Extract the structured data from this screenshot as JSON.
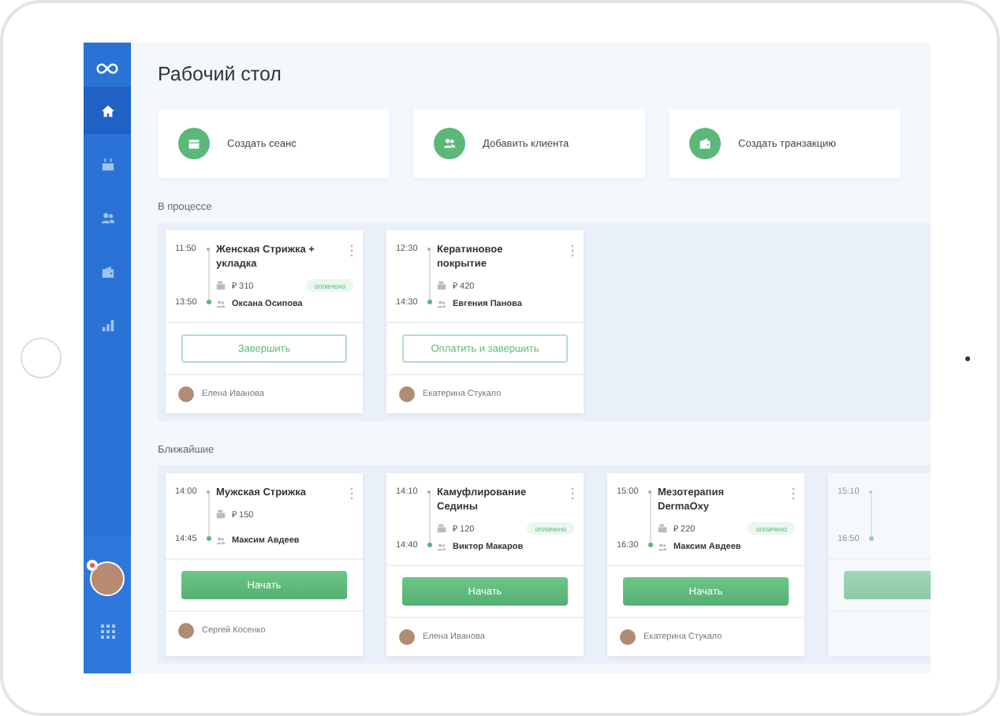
{
  "sidebar": {
    "items": [
      {
        "kind": "home",
        "selected": true
      },
      {
        "kind": "calendar",
        "selected": false
      },
      {
        "kind": "clients",
        "selected": false
      },
      {
        "kind": "wallet",
        "selected": false
      },
      {
        "kind": "stats",
        "selected": false
      }
    ]
  },
  "page_title": "Рабочий стол",
  "quick_actions": [
    {
      "kind": "calendar",
      "label": "Создать сеанс"
    },
    {
      "kind": "clients",
      "label": "Добавить клиента"
    },
    {
      "kind": "wallet",
      "label": "Создать транзакцию"
    }
  ],
  "sections": [
    {
      "title": "В процессе",
      "cards": [
        {
          "start": "11:50",
          "end": "13:50",
          "service": "Женская Стрижка + укладка",
          "price": "₽ 310",
          "badge": "оплачено",
          "client": "Оксана Осипова",
          "action": {
            "kind": "outline",
            "label": "Завершить"
          },
          "master": "Елена Иванова",
          "faded": false
        },
        {
          "start": "12:30",
          "end": "14:30",
          "service": "Кератиновое покрытие",
          "price": "₽ 420",
          "client": "Евгения Панова",
          "action": {
            "kind": "outline",
            "label": "Оплатить и завершить"
          },
          "master": "Екатерина Стукало",
          "faded": false
        }
      ]
    },
    {
      "title": "Ближайшие",
      "cards": [
        {
          "start": "14:00",
          "end": "14:45",
          "service": "Мужская Стрижка",
          "price": "₽ 150",
          "client": "Максим Авдеев",
          "action": {
            "kind": "primary",
            "label": "Начать"
          },
          "master": "Сергей Косенко",
          "faded": false
        },
        {
          "start": "14:10",
          "end": "14:40",
          "service": "Камуфлирование Седины",
          "price": "₽ 120",
          "badge": "оплачено",
          "client": "Виктор Макаров",
          "action": {
            "kind": "primary",
            "label": "Начать"
          },
          "master": "Елена Иванова",
          "faded": false
        },
        {
          "start": "15:00",
          "end": "16:30",
          "service": "Мезотерапия DermaOxy",
          "price": "₽ 220",
          "badge": "оплачено",
          "client": "Максим Авдеев",
          "action": {
            "kind": "primary",
            "label": "Начать"
          },
          "master": "Екатерина Стукало",
          "faded": false
        },
        {
          "start": "15:10",
          "end": "16:50",
          "action": {
            "kind": "primary"
          },
          "faded": true
        }
      ]
    }
  ]
}
